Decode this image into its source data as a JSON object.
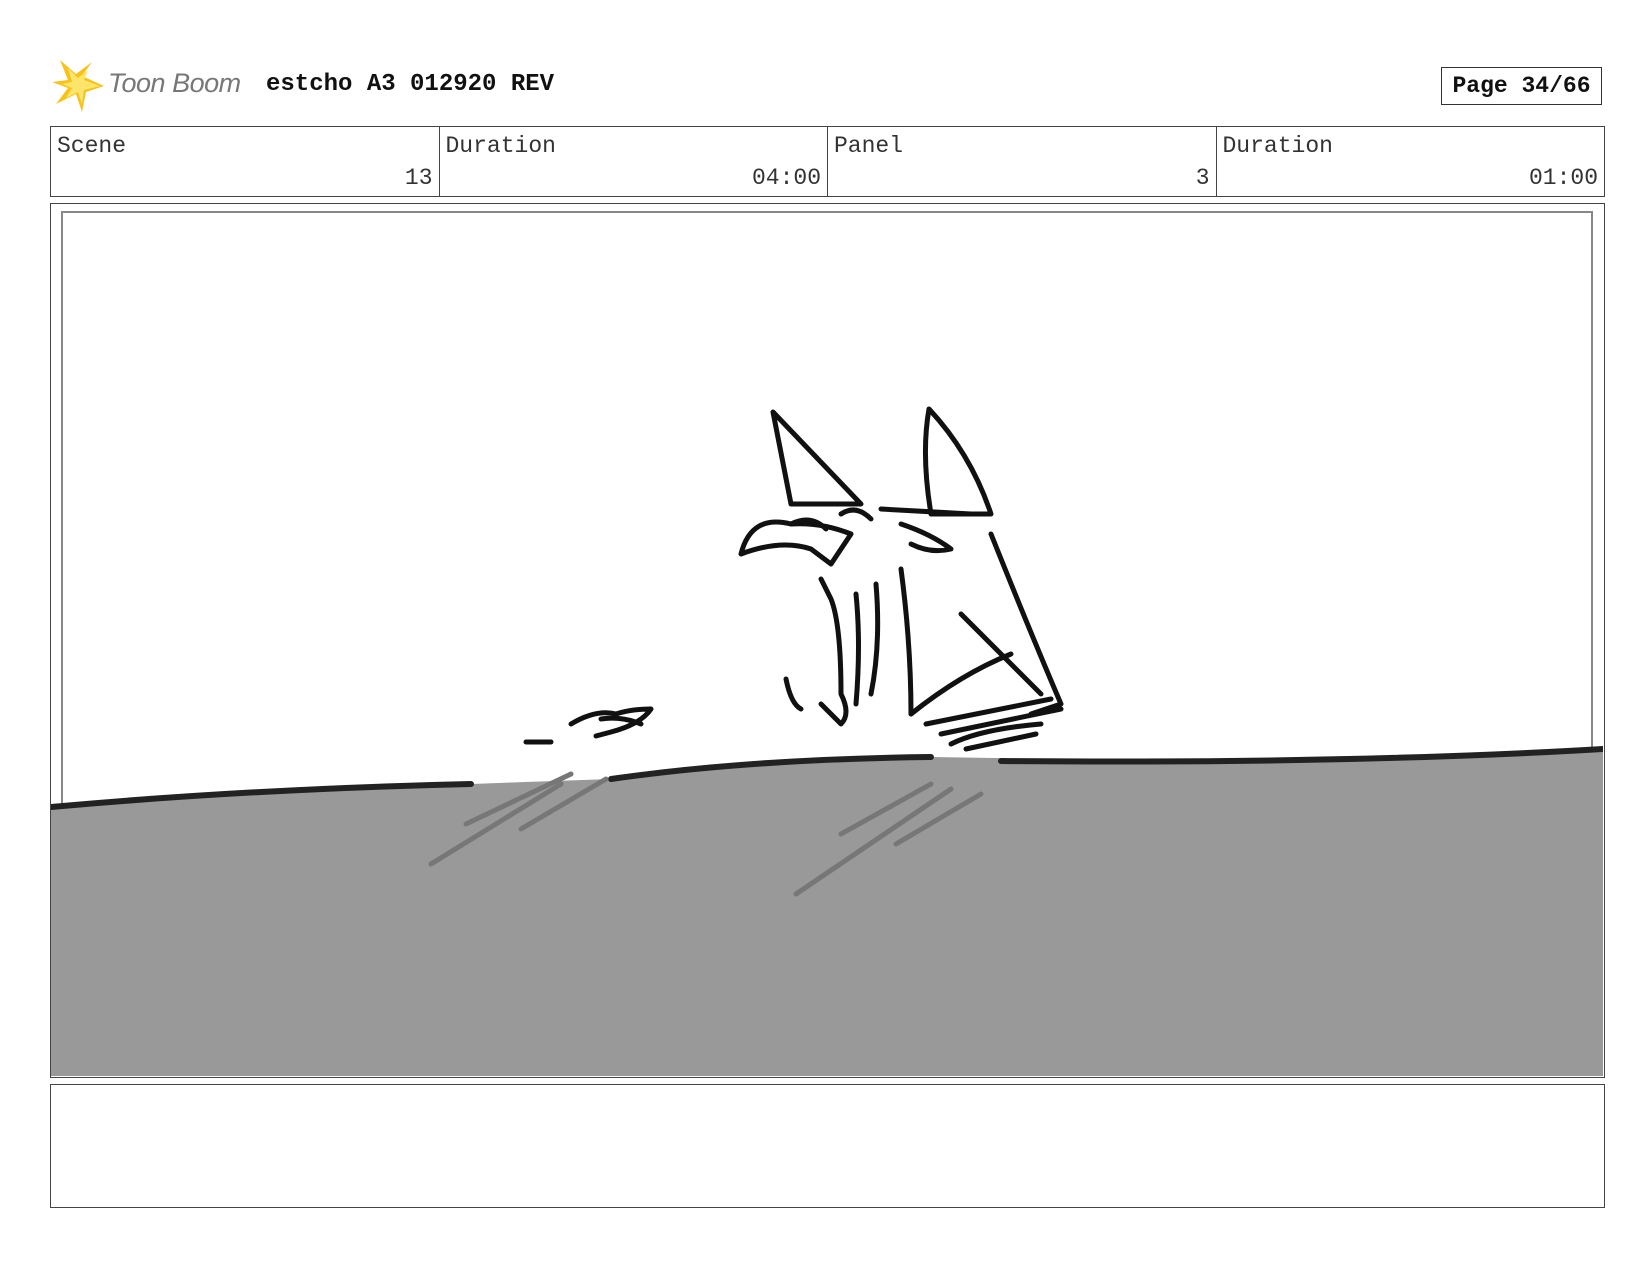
{
  "header": {
    "logo_text": "Toon Boom",
    "title": "estcho A3 012920 REV",
    "page_label": "Page 34/66"
  },
  "info": {
    "scene_label": "Scene",
    "scene_value": "13",
    "scene_duration_label": "Duration",
    "scene_duration_value": "04:00",
    "panel_label": "Panel",
    "panel_value": "3",
    "panel_duration_label": "Duration",
    "panel_duration_value": "01:00"
  },
  "colors": {
    "ground_fill": "#999999",
    "ink": "#111111",
    "logo_yellow": "#f7c21a"
  },
  "panel": {
    "icon": "sketch-drawing"
  },
  "notes": {
    "text": ""
  }
}
